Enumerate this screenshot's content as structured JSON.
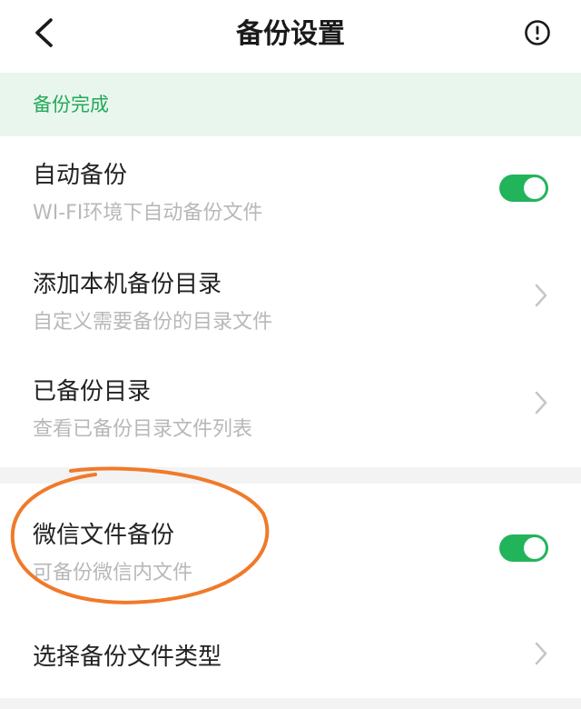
{
  "header": {
    "title": "备份设置",
    "back_icon": "chevron-left-icon",
    "info_icon": "alert-circle-icon"
  },
  "status": {
    "text": "备份完成"
  },
  "settings": {
    "auto_backup": {
      "title": "自动备份",
      "subtitle": "WI-FI环境下自动备份文件",
      "enabled": true
    },
    "add_local_dir": {
      "title": "添加本机备份目录",
      "subtitle": "自定义需要备份的目录文件"
    },
    "backed_up_dirs": {
      "title": "已备份目录",
      "subtitle": "查看已备份目录文件列表"
    },
    "wechat_backup": {
      "title": "微信文件备份",
      "subtitle": "可备份微信内文件",
      "enabled": true
    },
    "file_types": {
      "title": "选择备份文件类型"
    }
  },
  "colors": {
    "accent": "#22b45b",
    "status_bg": "#e9f6ee",
    "status_text": "#24a959",
    "annotation": "#f07a2a"
  }
}
